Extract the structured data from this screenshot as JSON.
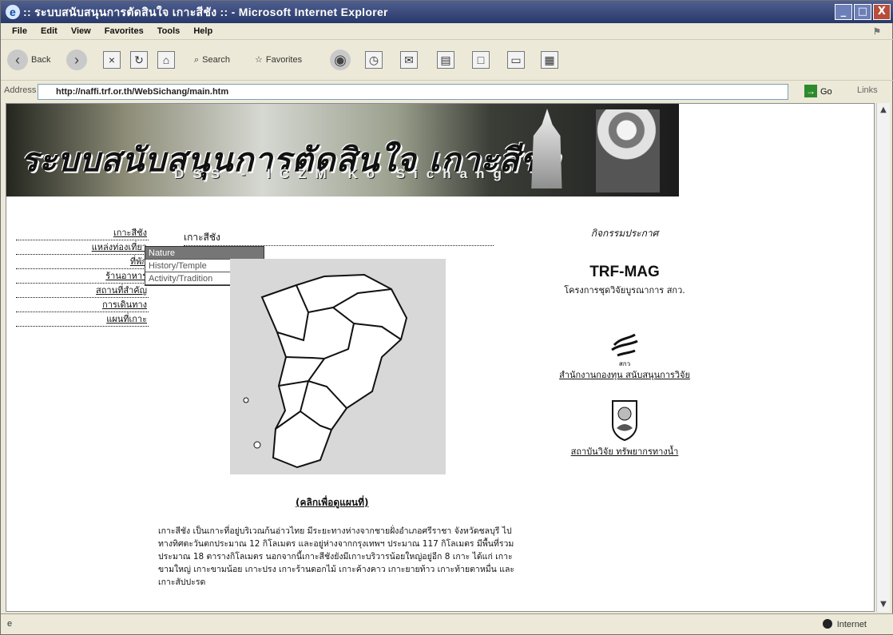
{
  "window": {
    "title": ":: ระบบสนับสนุนการตัดสินใจ เกาะสีชัง :: - Microsoft Internet Explorer",
    "minimize": "_",
    "maximize": "□",
    "close": "X"
  },
  "menu": [
    "File",
    "Edit",
    "View",
    "Favorites",
    "Tools",
    "Help"
  ],
  "toolbar": {
    "back": "Back",
    "search": "Search",
    "favorites": "Favorites"
  },
  "address": {
    "label": "Address",
    "url": "http://naffi.trf.or.th/WebSichang/main.htm",
    "go": "Go",
    "links": "Links"
  },
  "banner": {
    "title": "ระบบสนับสนุนการตัดสินใจ เกาะสีชัง",
    "subtitle": "DSS - ICZM Ko Sichang"
  },
  "nav": [
    "เกาะสีชัง",
    "แหล่งท่องเที่ยว",
    "ที่พัก",
    "ร้านอาหาร",
    "สถานที่สำคัญ",
    "การเดินทาง",
    "แผนที่เกาะ"
  ],
  "dropdown": [
    "Nature",
    "History/Temple",
    "Activity/Tradition"
  ],
  "main": {
    "section_title": "เกาะสีชัง",
    "map_link": "(คลิกเพื่อดูแผนที่)",
    "description": "เกาะสีชัง เป็นเกาะที่อยู่บริเวณก้นอ่าวไทย มีระยะทางห่างจากชายฝั่งอำเภอศรีราชา จังหวัดชลบุรี ไปทางทิศตะวันตกประมาณ 12 กิโลเมตร และอยู่ห่างจากกรุงเทพฯ ประมาณ 117 กิโลเมตร มีพื้นที่รวมประมาณ 18 ตารางกิโลเมตร นอกจากนี้เกาะสีชังยังมีเกาะบริวารน้อยใหญ่อยู่อีก 8 เกาะ ได้แก่ เกาะขามใหญ่ เกาะขามน้อย เกาะปรง เกาะร้านดอกไม้ เกาะค้างคาว เกาะยายท้าว เกาะท้ายตาหมื่น และเกาะสัปปะรด"
  },
  "right": {
    "announce": "กิจกรรมประกาศ",
    "mag_title": "TRF-MAG",
    "mag_subtitle": "โครงการชุดวิจัยบูรณาการ สกว.",
    "org1": "สำนักงานกองทุน สนับสนุนการวิจัย",
    "org2": "สถาบันวิจัย ทรัพยากรทางน้ำ"
  },
  "status": {
    "left": "e",
    "right": "Internet"
  }
}
